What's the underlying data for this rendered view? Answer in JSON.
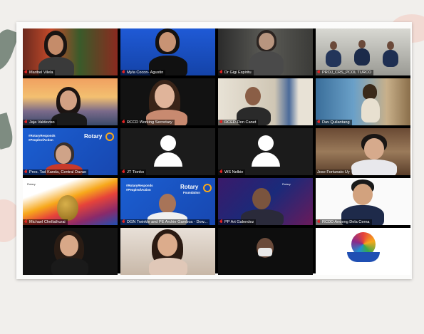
{
  "meeting": {
    "participants": [
      {
        "name": "Maribel Vilela"
      },
      {
        "name": "Myla Cocon- Agustin"
      },
      {
        "name": "Dr Gigi Espiritu"
      },
      {
        "name": "PROJ_CRS_PCOL TURCO"
      },
      {
        "name": "Jaja Valdeviso"
      },
      {
        "name": "RCCD Working Secretary"
      },
      {
        "name": "RCED-Don Canet"
      },
      {
        "name": "Dav Quilantang"
      },
      {
        "name": "Pres. Tad Kanda, Central Davao"
      },
      {
        "name": "JT Tionko"
      },
      {
        "name": "WS Nelbie"
      },
      {
        "name": "Jose Fortunato Uy"
      },
      {
        "name": "Michael Chellathurai"
      },
      {
        "name": "DGN Twinkle and PE Archie Gamboa - Dow..."
      },
      {
        "name": "PP Art Galendez"
      },
      {
        "name": "RCDD Andeng Dela Cerna"
      },
      {
        "name": ""
      },
      {
        "name": ""
      },
      {
        "name": ""
      },
      {
        "name": ""
      }
    ],
    "backgrounds": {
      "rotary_label": "Rotary",
      "hashtag_top": "#RotaryResponds",
      "hashtag_bottom": "#PeopleofAction",
      "foundation_label": "Foundation"
    }
  },
  "colors": {
    "active_speaker": "#31c95a",
    "muted_mic": "#e02424",
    "rotary_blue": "#1f4fb3",
    "rotary_gold": "#f7a81b"
  }
}
